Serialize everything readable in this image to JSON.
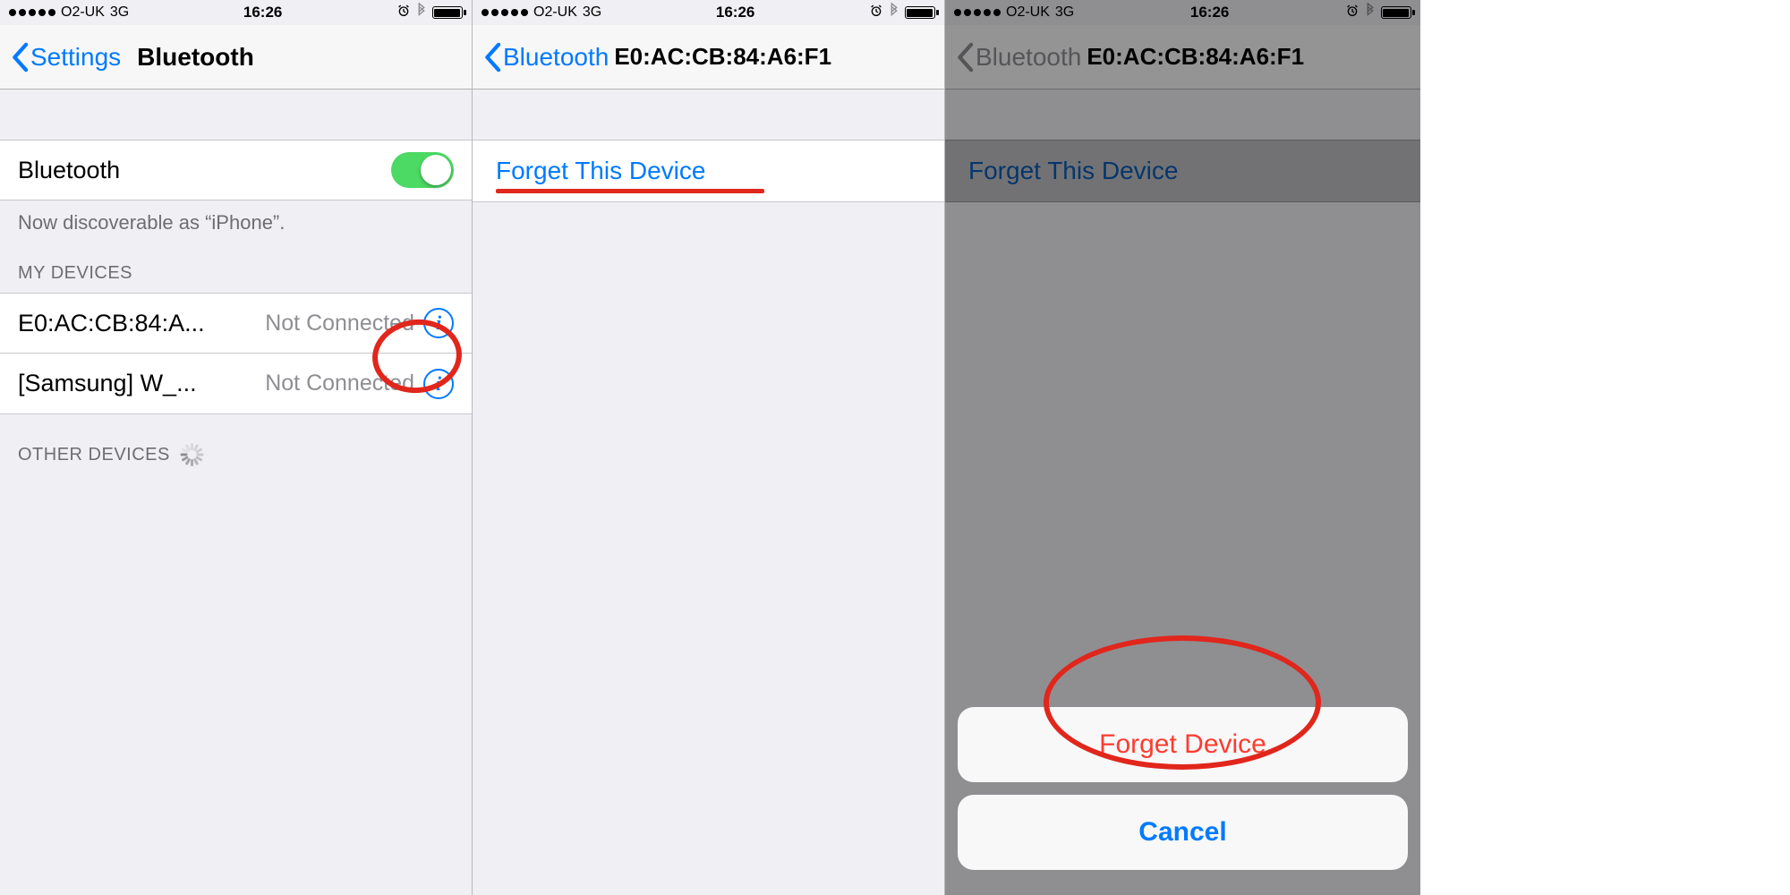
{
  "statusbar": {
    "carrier": "O2-UK",
    "network": "3G",
    "time": "16:26",
    "alarm_icon": "alarm-icon",
    "bluetooth_icon": "bluetooth-icon"
  },
  "panel1": {
    "nav": {
      "back_label": "Settings",
      "title": "Bluetooth"
    },
    "bluetooth_row": {
      "label": "Bluetooth",
      "on": true
    },
    "discoverable_text": "Now discoverable as “iPhone”.",
    "my_devices_header": "MY DEVICES",
    "devices": [
      {
        "name": "E0:AC:CB:84:A...",
        "status": "Not Connected"
      },
      {
        "name": "[Samsung] W_...",
        "status": "Not Connected"
      }
    ],
    "other_devices_header": "OTHER DEVICES"
  },
  "panel2": {
    "nav": {
      "back_label": "Bluetooth",
      "title": "E0:AC:CB:84:A6:F1"
    },
    "forget_label": "Forget This Device"
  },
  "panel3": {
    "nav": {
      "back_label": "Bluetooth",
      "title": "E0:AC:CB:84:A6:F1"
    },
    "forget_label": "Forget This Device",
    "sheet": {
      "destructive": "Forget Device",
      "cancel": "Cancel"
    }
  }
}
